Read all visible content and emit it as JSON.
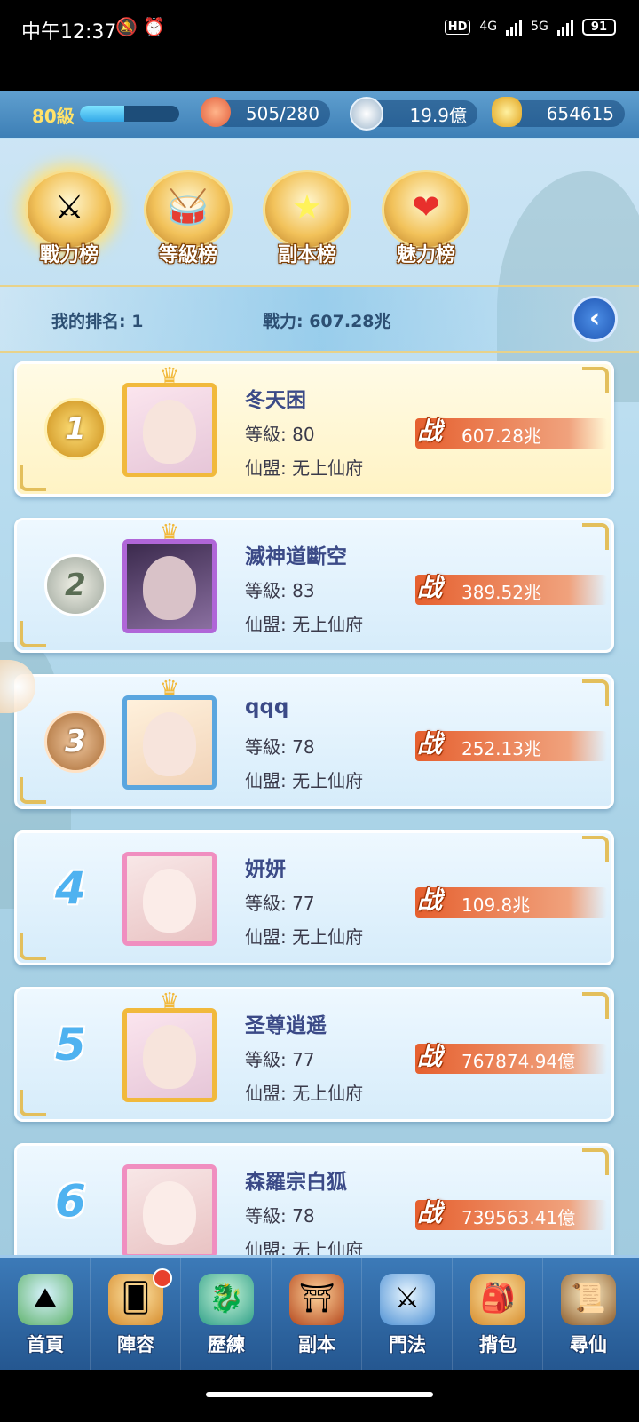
{
  "status_bar": {
    "time": "中午12:37",
    "status_icons": "🔕 ⏰",
    "hd": "HD",
    "net1": "4G",
    "net2": "5G",
    "battery": "91"
  },
  "resources": {
    "level": "80級",
    "exp_fraction": 0.45,
    "stamina": "505/280",
    "silver": "19.9億",
    "gold": "654615"
  },
  "tabs": [
    {
      "label": "戰力榜",
      "glyph": "⚔",
      "active": true
    },
    {
      "label": "等級榜",
      "glyph": "🥁",
      "active": false
    },
    {
      "label": "副本榜",
      "glyph": "★",
      "active": false
    },
    {
      "label": "魅力榜",
      "glyph": "❤",
      "active": false
    }
  ],
  "my_rank": {
    "rank_text": "我的排名: 1",
    "power_text": "戰力: 607.28兆",
    "back_icon": "‹"
  },
  "rank_list": [
    {
      "rank": "1",
      "name": "冬天困",
      "level": "等級: 80",
      "guild": "仙盟: 无上仙府",
      "power_glyph": "战",
      "power": "607.28兆"
    },
    {
      "rank": "2",
      "name": "滅神道斷空",
      "level": "等級: 83",
      "guild": "仙盟: 无上仙府",
      "power_glyph": "战",
      "power": "389.52兆"
    },
    {
      "rank": "3",
      "name": "qqq",
      "level": "等級: 78",
      "guild": "仙盟: 无上仙府",
      "power_glyph": "战",
      "power": "252.13兆"
    },
    {
      "rank": "4",
      "name": "妍妍",
      "level": "等級: 77",
      "guild": "仙盟: 无上仙府",
      "power_glyph": "战",
      "power": "109.8兆"
    },
    {
      "rank": "5",
      "name": "圣尊逍遥",
      "level": "等級: 77",
      "guild": "仙盟: 无上仙府",
      "power_glyph": "战",
      "power": "767874.94億"
    },
    {
      "rank": "6",
      "name": "森羅宗白狐",
      "level": "等級: 78",
      "guild": "仙盟: 无上仙府",
      "power_glyph": "战",
      "power": "739563.41億"
    }
  ],
  "nav": [
    {
      "label": "首頁",
      "glyph": "⛰"
    },
    {
      "label": "陣容",
      "glyph": "🂠",
      "badge": true
    },
    {
      "label": "歷練",
      "glyph": "🐉"
    },
    {
      "label": "副本",
      "glyph": "⛩"
    },
    {
      "label": "門法",
      "glyph": "⚔"
    },
    {
      "label": "揹包",
      "glyph": "🎒"
    },
    {
      "label": "尋仙",
      "glyph": "📜"
    }
  ]
}
